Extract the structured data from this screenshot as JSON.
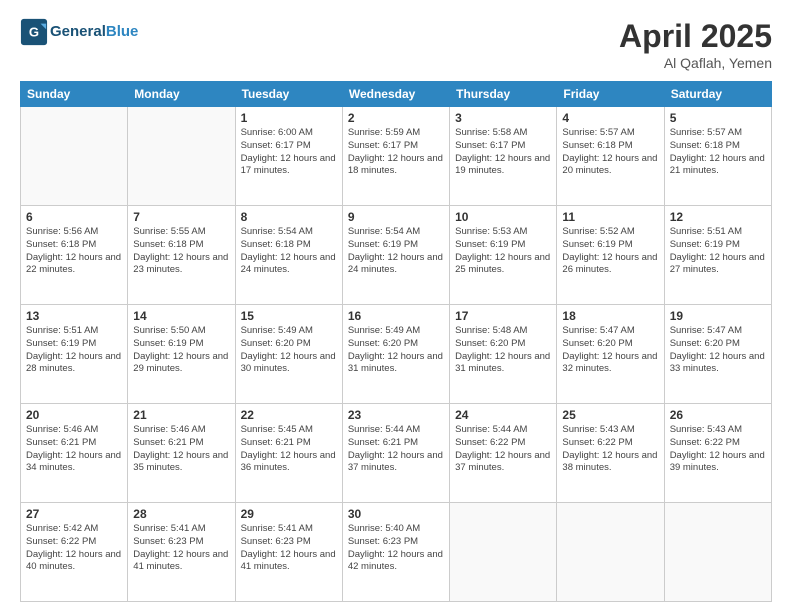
{
  "header": {
    "logo_line1": "General",
    "logo_line2": "Blue",
    "month": "April 2025",
    "location": "Al Qaflah, Yemen"
  },
  "weekdays": [
    "Sunday",
    "Monday",
    "Tuesday",
    "Wednesday",
    "Thursday",
    "Friday",
    "Saturday"
  ],
  "weeks": [
    [
      {
        "day": "",
        "info": ""
      },
      {
        "day": "",
        "info": ""
      },
      {
        "day": "1",
        "info": "Sunrise: 6:00 AM\nSunset: 6:17 PM\nDaylight: 12 hours and 17 minutes."
      },
      {
        "day": "2",
        "info": "Sunrise: 5:59 AM\nSunset: 6:17 PM\nDaylight: 12 hours and 18 minutes."
      },
      {
        "day": "3",
        "info": "Sunrise: 5:58 AM\nSunset: 6:17 PM\nDaylight: 12 hours and 19 minutes."
      },
      {
        "day": "4",
        "info": "Sunrise: 5:57 AM\nSunset: 6:18 PM\nDaylight: 12 hours and 20 minutes."
      },
      {
        "day": "5",
        "info": "Sunrise: 5:57 AM\nSunset: 6:18 PM\nDaylight: 12 hours and 21 minutes."
      }
    ],
    [
      {
        "day": "6",
        "info": "Sunrise: 5:56 AM\nSunset: 6:18 PM\nDaylight: 12 hours and 22 minutes."
      },
      {
        "day": "7",
        "info": "Sunrise: 5:55 AM\nSunset: 6:18 PM\nDaylight: 12 hours and 23 minutes."
      },
      {
        "day": "8",
        "info": "Sunrise: 5:54 AM\nSunset: 6:18 PM\nDaylight: 12 hours and 24 minutes."
      },
      {
        "day": "9",
        "info": "Sunrise: 5:54 AM\nSunset: 6:19 PM\nDaylight: 12 hours and 24 minutes."
      },
      {
        "day": "10",
        "info": "Sunrise: 5:53 AM\nSunset: 6:19 PM\nDaylight: 12 hours and 25 minutes."
      },
      {
        "day": "11",
        "info": "Sunrise: 5:52 AM\nSunset: 6:19 PM\nDaylight: 12 hours and 26 minutes."
      },
      {
        "day": "12",
        "info": "Sunrise: 5:51 AM\nSunset: 6:19 PM\nDaylight: 12 hours and 27 minutes."
      }
    ],
    [
      {
        "day": "13",
        "info": "Sunrise: 5:51 AM\nSunset: 6:19 PM\nDaylight: 12 hours and 28 minutes."
      },
      {
        "day": "14",
        "info": "Sunrise: 5:50 AM\nSunset: 6:19 PM\nDaylight: 12 hours and 29 minutes."
      },
      {
        "day": "15",
        "info": "Sunrise: 5:49 AM\nSunset: 6:20 PM\nDaylight: 12 hours and 30 minutes."
      },
      {
        "day": "16",
        "info": "Sunrise: 5:49 AM\nSunset: 6:20 PM\nDaylight: 12 hours and 31 minutes."
      },
      {
        "day": "17",
        "info": "Sunrise: 5:48 AM\nSunset: 6:20 PM\nDaylight: 12 hours and 31 minutes."
      },
      {
        "day": "18",
        "info": "Sunrise: 5:47 AM\nSunset: 6:20 PM\nDaylight: 12 hours and 32 minutes."
      },
      {
        "day": "19",
        "info": "Sunrise: 5:47 AM\nSunset: 6:20 PM\nDaylight: 12 hours and 33 minutes."
      }
    ],
    [
      {
        "day": "20",
        "info": "Sunrise: 5:46 AM\nSunset: 6:21 PM\nDaylight: 12 hours and 34 minutes."
      },
      {
        "day": "21",
        "info": "Sunrise: 5:46 AM\nSunset: 6:21 PM\nDaylight: 12 hours and 35 minutes."
      },
      {
        "day": "22",
        "info": "Sunrise: 5:45 AM\nSunset: 6:21 PM\nDaylight: 12 hours and 36 minutes."
      },
      {
        "day": "23",
        "info": "Sunrise: 5:44 AM\nSunset: 6:21 PM\nDaylight: 12 hours and 37 minutes."
      },
      {
        "day": "24",
        "info": "Sunrise: 5:44 AM\nSunset: 6:22 PM\nDaylight: 12 hours and 37 minutes."
      },
      {
        "day": "25",
        "info": "Sunrise: 5:43 AM\nSunset: 6:22 PM\nDaylight: 12 hours and 38 minutes."
      },
      {
        "day": "26",
        "info": "Sunrise: 5:43 AM\nSunset: 6:22 PM\nDaylight: 12 hours and 39 minutes."
      }
    ],
    [
      {
        "day": "27",
        "info": "Sunrise: 5:42 AM\nSunset: 6:22 PM\nDaylight: 12 hours and 40 minutes."
      },
      {
        "day": "28",
        "info": "Sunrise: 5:41 AM\nSunset: 6:23 PM\nDaylight: 12 hours and 41 minutes."
      },
      {
        "day": "29",
        "info": "Sunrise: 5:41 AM\nSunset: 6:23 PM\nDaylight: 12 hours and 41 minutes."
      },
      {
        "day": "30",
        "info": "Sunrise: 5:40 AM\nSunset: 6:23 PM\nDaylight: 12 hours and 42 minutes."
      },
      {
        "day": "",
        "info": ""
      },
      {
        "day": "",
        "info": ""
      },
      {
        "day": "",
        "info": ""
      }
    ]
  ]
}
